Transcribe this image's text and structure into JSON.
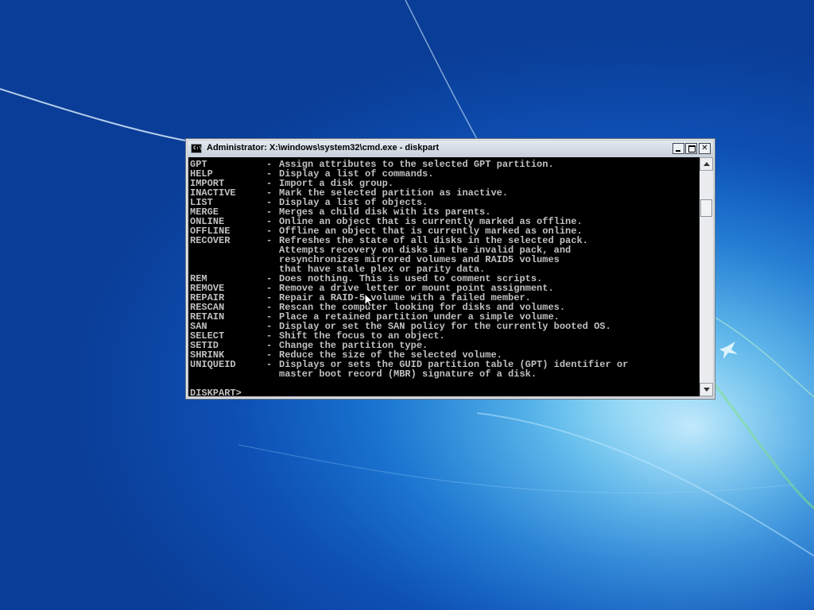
{
  "window": {
    "title": "Administrator: X:\\windows\\system32\\cmd.exe - diskpart",
    "icon_label": "C:\\"
  },
  "console": {
    "lines": [
      {
        "cmd": "GPT",
        "desc": "Assign attributes to the selected GPT partition."
      },
      {
        "cmd": "HELP",
        "desc": "Display a list of commands."
      },
      {
        "cmd": "IMPORT",
        "desc": "Import a disk group."
      },
      {
        "cmd": "INACTIVE",
        "desc": "Mark the selected partition as inactive."
      },
      {
        "cmd": "LIST",
        "desc": "Display a list of objects."
      },
      {
        "cmd": "MERGE",
        "desc": "Merges a child disk with its parents."
      },
      {
        "cmd": "ONLINE",
        "desc": "Online an object that is currently marked as offline."
      },
      {
        "cmd": "OFFLINE",
        "desc": "Offline an object that is currently marked as online."
      },
      {
        "cmd": "RECOVER",
        "desc": "Refreshes the state of all disks in the selected pack."
      },
      {
        "cmd": "",
        "desc": "Attempts recovery on disks in the invalid pack, and"
      },
      {
        "cmd": "",
        "desc": "resynchronizes mirrored volumes and RAID5 volumes"
      },
      {
        "cmd": "",
        "desc": "that have stale plex or parity data."
      },
      {
        "cmd": "REM",
        "desc": "Does nothing. This is used to comment scripts."
      },
      {
        "cmd": "REMOVE",
        "desc": "Remove a drive letter or mount point assignment."
      },
      {
        "cmd": "REPAIR",
        "desc": "Repair a RAID-5 volume with a failed member."
      },
      {
        "cmd": "RESCAN",
        "desc": "Rescan the computer looking for disks and volumes."
      },
      {
        "cmd": "RETAIN",
        "desc": "Place a retained partition under a simple volume."
      },
      {
        "cmd": "SAN",
        "desc": "Display or set the SAN policy for the currently booted OS."
      },
      {
        "cmd": "SELECT",
        "desc": "Shift the focus to an object."
      },
      {
        "cmd": "SETID",
        "desc": "Change the partition type."
      },
      {
        "cmd": "SHRINK",
        "desc": "Reduce the size of the selected volume."
      },
      {
        "cmd": "UNIQUEID",
        "desc": "Displays or sets the GUID partition table (GPT) identifier or"
      },
      {
        "cmd": "",
        "desc": "master boot record (MBR) signature of a disk."
      }
    ],
    "prompt": "DISKPART> "
  },
  "colors": {
    "console_bg": "#000000",
    "console_text": "#c0c0c0",
    "desktop": "#0e4fb3"
  },
  "icons": {
    "minimize": "minimize-icon",
    "maximize": "maximize-icon",
    "close": "close-icon",
    "scroll_up": "arrow-up-icon",
    "scroll_down": "arrow-down-icon",
    "pointer": "mouse-pointer-icon"
  }
}
